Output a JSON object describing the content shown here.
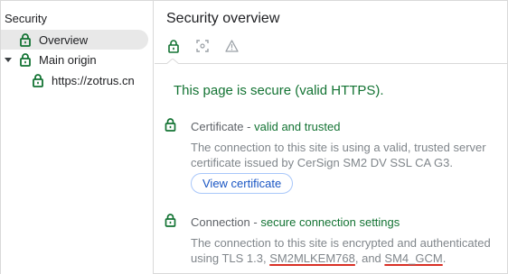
{
  "sidebar": {
    "title": "Security",
    "items": [
      {
        "label": "Overview"
      },
      {
        "label": "Main origin"
      },
      {
        "label": "https://zotrus.cn"
      }
    ]
  },
  "main": {
    "title": "Security overview",
    "tabs": [
      {
        "icon": "lock-icon"
      },
      {
        "icon": "screenshot-frame-icon"
      },
      {
        "icon": "warning-icon"
      }
    ],
    "status_heading": "This page is secure (valid HTTPS).",
    "certificate": {
      "label": "Certificate",
      "separator": " - ",
      "status": "valid and trusted",
      "description": "The connection to this site is using a valid, trusted server certificate issued by CerSign SM2 DV SSL CA G3.",
      "button_label": "View certificate"
    },
    "connection": {
      "label": "Connection",
      "separator": " - ",
      "status": "secure connection settings",
      "description_prefix": "The connection to this site is encrypted and authenticated using TLS 1.3, ",
      "key_exchange": "SM2MLKEM768",
      "joiner": ", and ",
      "cipher": "SM4_GCM",
      "suffix": "."
    }
  },
  "colors": {
    "secure_green": "#137333",
    "muted_text": "#80868b",
    "link_blue": "#1a56c4",
    "underline_red": "#d93025"
  }
}
